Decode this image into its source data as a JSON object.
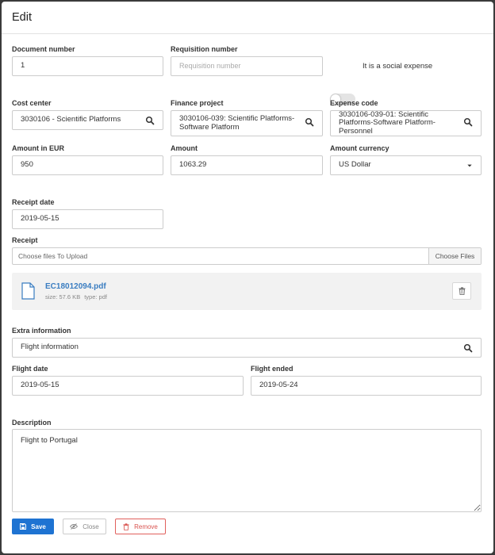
{
  "modal": {
    "title": "Edit"
  },
  "document_number": {
    "label": "Document number",
    "value": "1"
  },
  "requisition_number": {
    "label": "Requisition number",
    "placeholder": "Requisition number",
    "value": ""
  },
  "social_expense": {
    "label": "It is a social expense",
    "checked": false
  },
  "cost_center": {
    "label": "Cost center",
    "value": "3030106 - Scientific Platforms",
    "icon": "search-icon"
  },
  "finance_project": {
    "label": "Finance project",
    "value": "3030106-039: Scientific Platforms-Software Platform",
    "icon": "search-icon"
  },
  "expense_code": {
    "label": "Expense code",
    "value": "3030106-039-01: Scientific Platforms-Software Platform-Personnel",
    "icon": "search-icon"
  },
  "amount_eur": {
    "label": "Amount in EUR",
    "value": "950"
  },
  "amount": {
    "label": "Amount",
    "value": "1063.29"
  },
  "amount_currency": {
    "label": "Amount currency",
    "value": "US Dollar"
  },
  "receipt_date": {
    "label": "Receipt date",
    "value": "2019-05-15"
  },
  "receipt": {
    "label": "Receipt",
    "placeholder": "Choose files To Upload",
    "choose_label": "Choose Files",
    "file": {
      "name": "EC18012094.pdf",
      "size": "size: 57.6 KB",
      "type": "type: pdf"
    }
  },
  "extra_information": {
    "label": "Extra information",
    "value": "Flight information"
  },
  "flight_date": {
    "label": "Flight date",
    "value": "2019-05-15"
  },
  "flight_ended": {
    "label": "Flight ended",
    "value": "2019-05-24"
  },
  "description": {
    "label": "Description",
    "value": "Flight to Portugal"
  },
  "actions": {
    "save": "Save",
    "close": "Close",
    "remove": "Remove"
  },
  "colors": {
    "primary": "#1e73d2",
    "danger": "#d9534f",
    "link": "#3a7dc1"
  }
}
